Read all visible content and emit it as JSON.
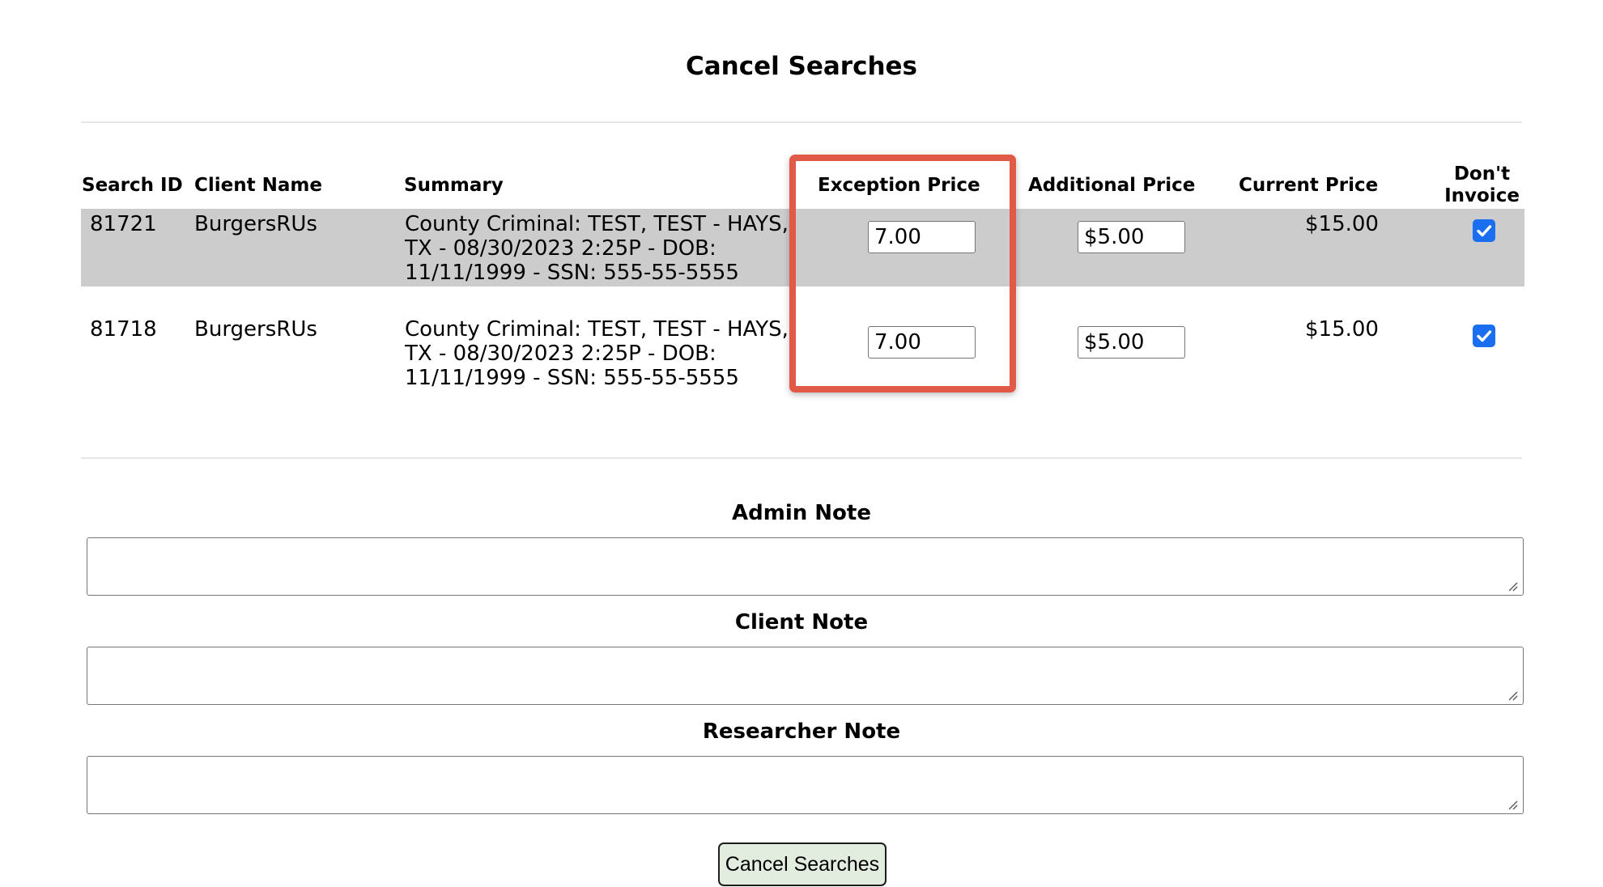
{
  "page": {
    "title": "Cancel Searches"
  },
  "table": {
    "headers": {
      "search_id": "Search ID",
      "client_name": "Client Name",
      "summary": "Summary",
      "exception_price": "Exception Price",
      "additional_price": "Additional Price",
      "current_price": "Current Price",
      "dont_invoice": "Don't Invoice"
    },
    "rows": [
      {
        "search_id": "81721",
        "client_name": "BurgersRUs",
        "summary": "County Criminal: TEST, TEST - HAYS, TX - 08/30/2023 2:25P - DOB: 11/11/1999 - SSN: 555-55-5555",
        "exception_price": "7.00",
        "additional_price": "$5.00",
        "current_price": "$15.00",
        "dont_invoice": true
      },
      {
        "search_id": "81718",
        "client_name": "BurgersRUs",
        "summary": "County Criminal: TEST, TEST - HAYS, TX - 08/30/2023 2:25P - DOB: 11/11/1999 - SSN: 555-55-5555",
        "exception_price": "7.00",
        "additional_price": "$5.00",
        "current_price": "$15.00",
        "dont_invoice": true
      }
    ]
  },
  "notes": {
    "admin_label": "Admin Note",
    "client_label": "Client Note",
    "researcher_label": "Researcher Note"
  },
  "actions": {
    "submit_label": "Cancel Searches"
  },
  "colors": {
    "highlight_border": "#e15a48",
    "row_highlight": "#cccccc",
    "checkbox": "#1a6ff0",
    "button_bg": "#e2ecdf"
  }
}
